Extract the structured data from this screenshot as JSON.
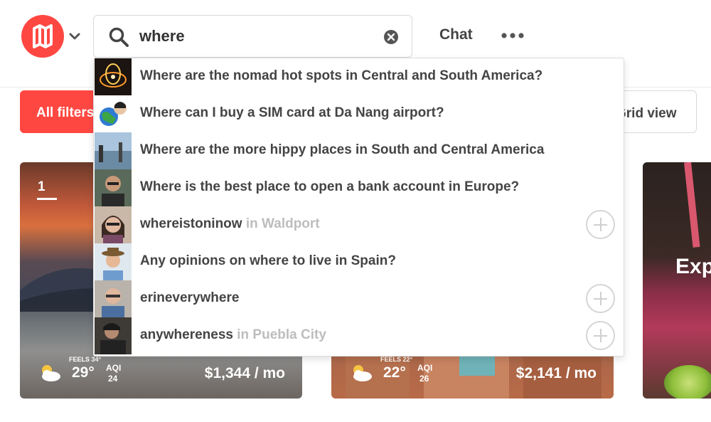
{
  "header": {
    "logo_icon": "nomad-list-logo-icon",
    "search": {
      "value": "where",
      "placeholder": ""
    },
    "chat_label": "Chat",
    "more_icon": "ellipsis-icon"
  },
  "filters": {
    "all_filters_label": "All filters",
    "view_label": "Grid view"
  },
  "cards": [
    {
      "rank": "1",
      "feels": "FEELS 34°",
      "temp": "29°",
      "aqi_label": "AQI",
      "aqi": "24",
      "cost": "$1,344 / mo",
      "weather_icon": "partly-cloudy-icon"
    },
    {
      "feels": "FEELS 22°",
      "temp": "22°",
      "aqi_label": "AQI",
      "aqi": "26",
      "cost": "$2,141 / mo",
      "weather_icon": "partly-cloudy-icon"
    },
    {
      "title": "Exp"
    }
  ],
  "suggestions": [
    {
      "text": "Where are the nomad hot spots in Central and South America?",
      "location": "",
      "addable": false,
      "thumb": "fire-dancer-thumb"
    },
    {
      "text": "Where can I buy a SIM card at Da Nang airport?",
      "location": "",
      "addable": false,
      "thumb": "globe-avatar-thumb"
    },
    {
      "text": "Where are the more hippy places in South and Central America",
      "location": "",
      "addable": false,
      "thumb": "beach-photo-thumb"
    },
    {
      "text": "Where is the best place to open a bank account in Europe?",
      "location": "",
      "addable": false,
      "thumb": "man-portrait-thumb"
    },
    {
      "text": "whereistoninow",
      "location": "in Waldport",
      "addable": true,
      "thumb": "woman-glasses-avatar"
    },
    {
      "text": "Any opinions on where to live in Spain?",
      "location": "",
      "addable": false,
      "thumb": "man-hat-avatar"
    },
    {
      "text": "erineverywhere",
      "location": "",
      "addable": true,
      "thumb": "woman-scarf-avatar"
    },
    {
      "text": "anywhereness",
      "location": "in Puebla City",
      "addable": true,
      "thumb": "man-dark-avatar"
    }
  ],
  "colors": {
    "accent": "#ff4742",
    "text": "#444444",
    "muted": "#bdbdbd"
  }
}
